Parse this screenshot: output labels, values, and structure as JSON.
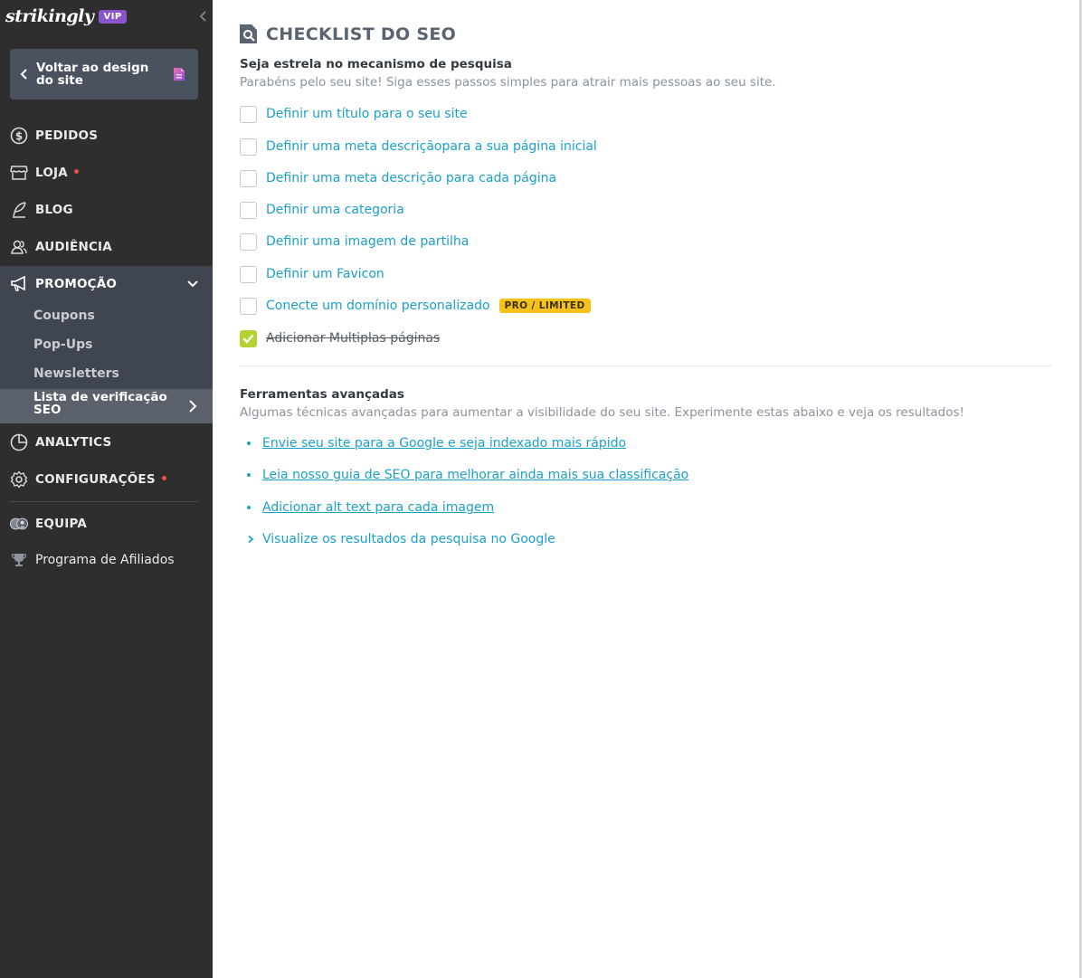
{
  "sidebar": {
    "brand": "strikingly",
    "vip": "VIP",
    "back_button": "Voltar ao design do site",
    "nav": {
      "orders": "PEDIDOS",
      "store": "LOJA",
      "blog": "BLOG",
      "audience": "AUDIÊNCIA",
      "promotion": "PROMOÇÃO",
      "analytics": "ANALYTICS",
      "settings": "CONFIGURAÇÕES",
      "team": "EQUIPA",
      "affiliates": "Programa de Afiliados"
    },
    "promotion_items": {
      "coupons": "Coupons",
      "popups": "Pop-Ups",
      "newsletters": "Newsletters",
      "seo_checklist": "Lista de verificação SEO"
    }
  },
  "main": {
    "title": "CHECKLIST DO SEO",
    "search_section": {
      "title": "Seja estrela no mecanismo de pesquisa",
      "subtitle": "Parabéns pelo seu site! Siga esses passos simples para atrair mais pessoas ao seu site."
    },
    "checklist": [
      {
        "label": "Definir um título para o seu site",
        "checked": false
      },
      {
        "label": "Definir uma meta descriçãopara a sua página inicial",
        "checked": false
      },
      {
        "label": "Definir uma meta descrição para cada página",
        "checked": false
      },
      {
        "label": "Definir uma categoria",
        "checked": false
      },
      {
        "label": "Definir uma imagem de partilha",
        "checked": false
      },
      {
        "label": "Definir um Favicon",
        "checked": false
      },
      {
        "label": "Conecte um domínio personalizado",
        "checked": false,
        "badge": "PRO / LIMITED"
      },
      {
        "label": "Adicionar Multiplas páginas",
        "checked": true
      }
    ],
    "advanced": {
      "title": "Ferramentas avançadas",
      "subtitle": "Algumas técnicas avançadas para aumentar a visibilidade do seu site. Experimente estas abaixo e veja os resultados!",
      "links": [
        "Envie seu site para a Google e seja indexado mais rápido",
        "Leia nosso guia de SEO para melhorar ainda mais sua classificação",
        "Adicionar alt text para cada imagem"
      ],
      "expand_label": "Visualize os resultados da pesquisa no Google"
    }
  }
}
